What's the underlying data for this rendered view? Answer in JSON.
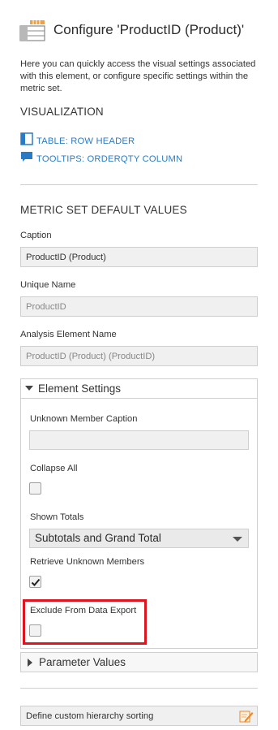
{
  "header": {
    "title": "Configure 'ProductID (Product)'",
    "description": "Here you can quickly access the visual settings associated with this element, or configure specific settings within the metric set."
  },
  "visualization": {
    "heading": "VISUALIZATION",
    "links": [
      {
        "label": "TABLE: ROW HEADER",
        "icon": "table-icon"
      },
      {
        "label": "TOOLTIPS: ORDERQTY COLUMN",
        "icon": "tooltip-icon"
      }
    ]
  },
  "metric_set": {
    "heading": "METRIC SET DEFAULT VALUES",
    "caption_label": "Caption",
    "caption_value": "ProductID (Product)",
    "unique_name_label": "Unique Name",
    "unique_name_value": "ProductID",
    "analysis_label": "Analysis Element Name",
    "analysis_value": "ProductID (Product) (ProductID)"
  },
  "element_settings": {
    "title": "Element Settings",
    "expanded": true,
    "unknown_member_caption_label": "Unknown Member Caption",
    "unknown_member_caption_value": "",
    "collapse_all_label": "Collapse All",
    "collapse_all_checked": false,
    "shown_totals_label": "Shown Totals",
    "shown_totals_value": "Subtotals and Grand Total",
    "retrieve_unknown_label": "Retrieve Unknown Members",
    "retrieve_unknown_checked": true,
    "exclude_export_label": "Exclude From Data Export",
    "exclude_export_checked": false
  },
  "parameter_values": {
    "title": "Parameter Values",
    "expanded": false
  },
  "custom_sorting": {
    "label": "Define custom hierarchy sorting"
  },
  "colors": {
    "link": "#2b7bc4",
    "highlight": "#e0141e",
    "edit_icon": "#e8872b"
  }
}
